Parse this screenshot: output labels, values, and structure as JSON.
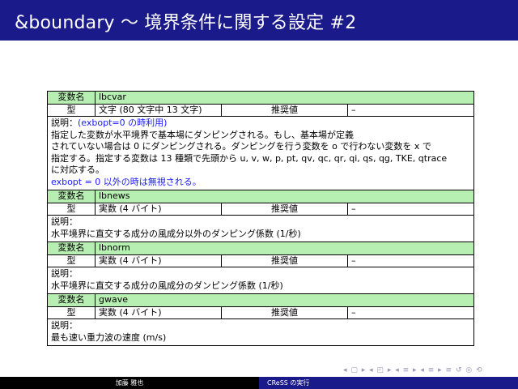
{
  "slide": {
    "title": "&boundary 〜 境界条件に関する設定 #2"
  },
  "labels": {
    "var_name": "変数名",
    "type": "型",
    "default": "推奨値",
    "desc": "説明："
  },
  "rows": [
    {
      "name": "lbcvar",
      "type": "文字 (80 文字中 13 文字)",
      "default": "–",
      "desc_prefix": "(exbopt=0",
      "desc_prefix_suffix": " の時利用)",
      "desc_lines": [
        "指定した変数が水平境界で基本場にダンピングされる。もし、基本場が定義",
        "されていない場合は 0 にダンピングされる。ダンピングを行う変数を o で行わない変数を x で",
        "指定する。指定する変数は 13 種類で先頭から u, v, w, p, pt, qv, qc, qr, qi, qs, qg, TKE, qtrace",
        "に対応する。"
      ],
      "desc_note": "exbopt = 0 以外の時は無視される。"
    },
    {
      "name": "lbnews",
      "type": "実数 (4 バイト)",
      "default": "–",
      "desc_lines": [
        "水平境界に直交する成分の風成分以外のダンピング係数 (1/秒)"
      ]
    },
    {
      "name": "lbnorm",
      "type": "実数 (4 バイト)",
      "default": "–",
      "desc_lines": [
        "水平境界に直交する成分の風成分のダンピング係数 (1/秒)"
      ]
    },
    {
      "name": "gwave",
      "type": "実数 (4 バイト)",
      "default": "–",
      "desc_lines": [
        "最も速い重力波の速度 (m/s)"
      ]
    }
  ],
  "footer": {
    "author": "加藤 雅也",
    "section": "CReSS の実行"
  },
  "nav": {
    "symbols": "◂ ▢ ▸  ◂ ◰ ▸  ◂ ≡ ▸  ◂ ≡ ▸   ≡   ↺ ◎ ⟲"
  },
  "colors": {
    "titlebar": "#1a1a8a",
    "header_row": "#b7eeb2",
    "accent_text": "#1a1aff"
  }
}
